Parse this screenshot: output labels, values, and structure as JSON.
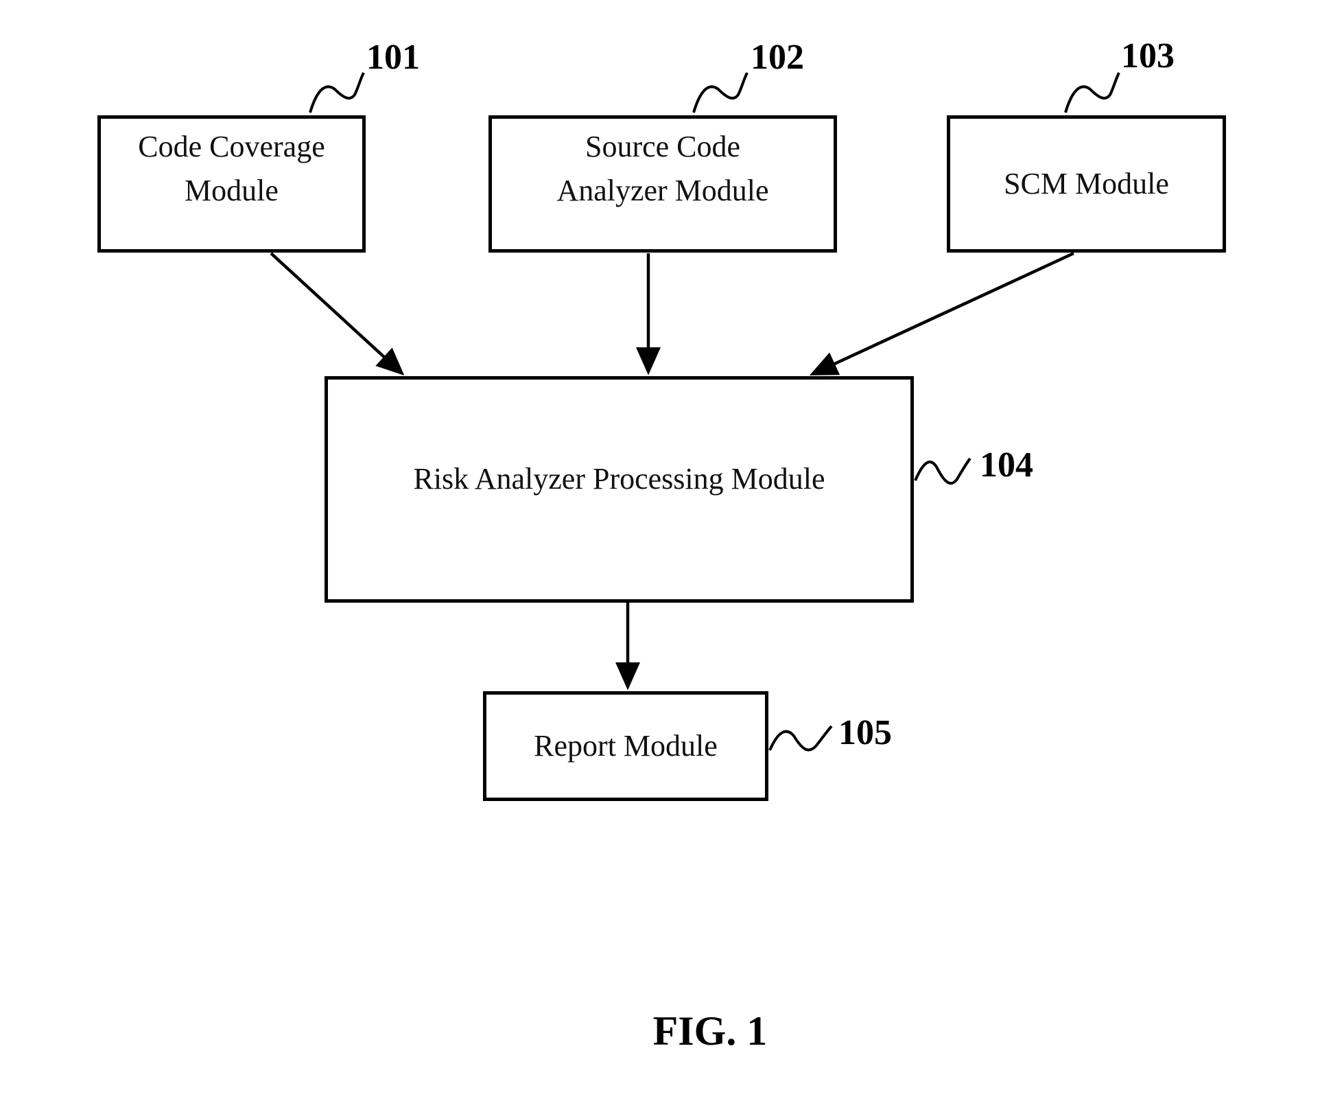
{
  "figure": {
    "caption": "FIG. 1",
    "modules": [
      {
        "ref": "101",
        "label": "Code Coverage\nModule"
      },
      {
        "ref": "102",
        "label": "Source Code\nAnalyzer Module"
      },
      {
        "ref": "103",
        "label": "SCM Module"
      },
      {
        "ref": "104",
        "label": "Risk Analyzer Processing Module"
      },
      {
        "ref": "105",
        "label": "Report Module"
      }
    ],
    "connections": [
      {
        "from": "101",
        "to": "104"
      },
      {
        "from": "102",
        "to": "104"
      },
      {
        "from": "103",
        "to": "104"
      },
      {
        "from": "104",
        "to": "105"
      }
    ],
    "colors": {
      "line": "#000000",
      "background": "#ffffff"
    }
  }
}
